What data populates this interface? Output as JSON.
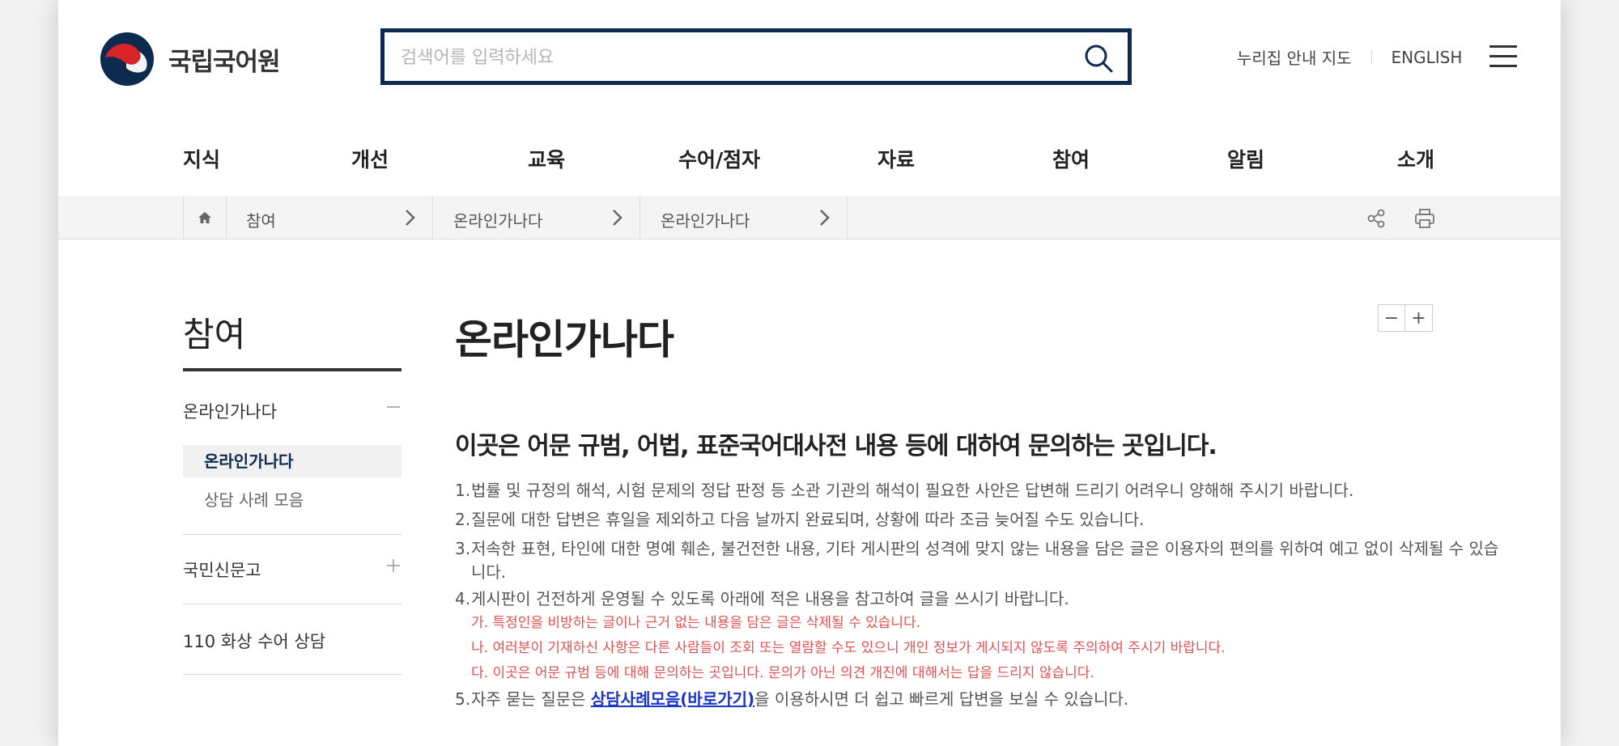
{
  "header": {
    "logo_text": "국립국어원",
    "search_placeholder": "검색어를 입력하세요",
    "util_links": [
      "누리집 안내 지도",
      "ENGLISH"
    ],
    "colors": {
      "brand_navy": "#0d2b4f",
      "logo_red": "#d8232a"
    }
  },
  "gnb": [
    "지식",
    "개선",
    "교육",
    "수어/점자",
    "자료",
    "참여",
    "알림",
    "소개"
  ],
  "breadcrumb": {
    "items": [
      "참여",
      "온라인가나다",
      "온라인가나다"
    ],
    "home_icon": "home-icon",
    "tools": [
      "share-icon",
      "print-icon"
    ]
  },
  "lnb": {
    "title": "참여",
    "groups": [
      {
        "label": "온라인가나다",
        "expanded": true,
        "subitems": [
          "온라인가나다",
          "상담 사례 모음"
        ],
        "active_sub": 0
      },
      {
        "label": "국민신문고",
        "expanded": false
      },
      {
        "label": "110 화상 수어 상담",
        "expanded": false
      }
    ]
  },
  "content": {
    "title": "온라인가나다",
    "zoom_out": "−",
    "zoom_in": "+",
    "intro": "이곳은 어문 규범, 어법, 표준국어대사전 내용 등에 대하여 문의하는 곳입니다.",
    "rules": [
      {
        "num": "1.",
        "text": "법률 및 규정의 해석, 시험 문제의 정답 판정 등 소관 기관의 해석이 필요한 사안은 답변해 드리기 어려우니 양해해 주시기 바랍니다."
      },
      {
        "num": "2.",
        "text": "질문에 대한 답변은 휴일을 제외하고 다음 날까지 완료되며, 상황에 따라 조금 늦어질 수도 있습니다."
      },
      {
        "num": "3.",
        "text": "저속한 표현, 타인에 대한 명예 훼손, 불건전한 내용, 기타 게시판의 성격에 맞지 않는 내용을 담은 글은 이용자의 편의를 위하여 예고 없이 삭제될 수 있습니다."
      },
      {
        "num": "4.",
        "text": "게시판이 건전하게 운영될 수 있도록 아래에 적은 내용을 참고하여 글을 쓰시기 바랍니다."
      }
    ],
    "sub_rules": [
      "가. 특정인을 비방하는 글이나 근거 없는 내용을 담은 글은 삭제될 수 있습니다.",
      "나. 여러분이 기재하신 사항은 다른 사람들이 조회 또는 열람할 수도 있으니 개인 정보가 게시되지 않도록 주의하여 주시기 바랍니다.",
      "다. 이곳은 어문 규범 등에 대해 문의하는 곳입니다. 문의가 아닌 의견 개진에 대해서는 답을 드리지 않습니다."
    ],
    "rule5": {
      "num": "5.",
      "prefix": "자주 묻는 질문은 ",
      "link": "상담사례모음(바로가기)",
      "suffix": "을 이용하시면 더 쉽고 빠르게 답변을 보실 수 있습니다."
    },
    "colors": {
      "sub_rule_red": "#e05252",
      "link_blue": "#1a34c7"
    }
  }
}
